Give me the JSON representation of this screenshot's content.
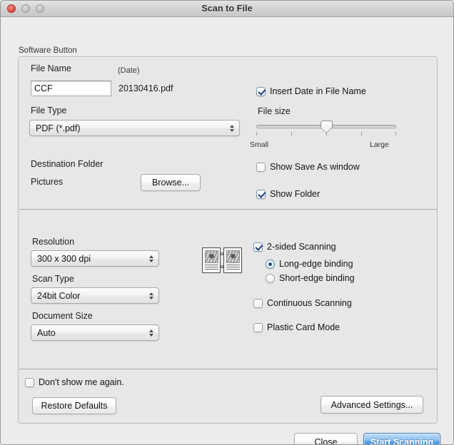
{
  "window": {
    "title": "Scan to File",
    "traffic_lights": [
      "close-button",
      "minimize-button",
      "zoom-button"
    ]
  },
  "group": {
    "caption": "Software Button"
  },
  "file_section": {
    "file_name_label": "File Name",
    "date_label": "(Date)",
    "file_name_value": "CCF",
    "date_value": "20130416.pdf",
    "file_type_label": "File Type",
    "file_type_value": "PDF (*.pdf)",
    "destination_folder_label": "Destination Folder",
    "destination_folder_value": "Pictures",
    "browse_button": "Browse..."
  },
  "options_right": {
    "insert_date_label": "Insert Date in File Name",
    "insert_date_checked": true,
    "file_size_label": "File size",
    "file_size_small": "Small",
    "file_size_large": "Large",
    "file_size_value": 50,
    "file_size_ticks": 5,
    "show_save_as_label": "Show Save As window",
    "show_save_as_checked": false,
    "show_folder_label": "Show Folder",
    "show_folder_checked": true
  },
  "scan_section": {
    "resolution_label": "Resolution",
    "resolution_value": "300 x 300 dpi",
    "scan_type_label": "Scan Type",
    "scan_type_value": "24bit Color",
    "document_size_label": "Document Size",
    "document_size_value": "Auto",
    "two_sided_label": "2-sided Scanning",
    "two_sided_checked": true,
    "long_edge_label": "Long-edge binding",
    "long_edge_selected": true,
    "short_edge_label": "Short-edge binding",
    "short_edge_selected": false,
    "continuous_label": "Continuous Scanning",
    "continuous_checked": false,
    "plastic_card_label": "Plastic Card Mode",
    "plastic_card_checked": false,
    "duplex_icon": "two-page-spread-icon"
  },
  "footer": {
    "dont_show_label": "Don't show me again.",
    "dont_show_checked": false,
    "restore_defaults_button": "Restore Defaults",
    "advanced_settings_button": "Advanced Settings...",
    "close_button": "Close",
    "start_scanning_button": "Start Scanning"
  },
  "colors": {
    "default_button_blue": "#4f9ce8",
    "window_background": "#ececec",
    "group_background": "#e7e7e7",
    "checkmark": "#1d3f77",
    "radio_dot": "#1f4f91"
  }
}
